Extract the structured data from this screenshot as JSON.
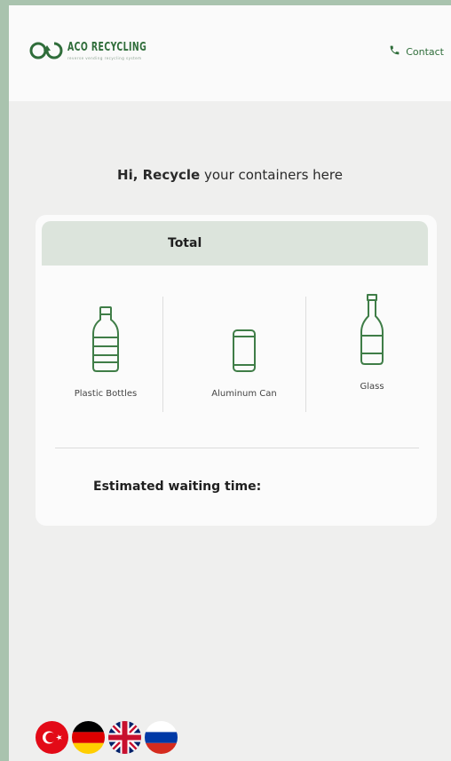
{
  "header": {
    "brand": "ACO RECYCLING",
    "tagline": "reverse vending recycling system",
    "contact_label": "Contact"
  },
  "greeting": {
    "lead": "Hi, Recycle",
    "rest": " your containers here"
  },
  "card": {
    "total_label": "Total",
    "items": [
      {
        "label": "Plastic Bottles",
        "icon": "plastic-bottle-icon"
      },
      {
        "label": "Aluminum Can",
        "icon": "aluminum-can-icon"
      },
      {
        "label": "Glass",
        "icon": "glass-bottle-icon"
      }
    ],
    "waiting_label": "Estimated waiting time:"
  },
  "languages": [
    "Turkish",
    "German",
    "English",
    "Russian"
  ],
  "colors": {
    "accent": "#2f6d3a",
    "icon_green": "#3f7d47",
    "total_bar": "#dce4dc"
  }
}
